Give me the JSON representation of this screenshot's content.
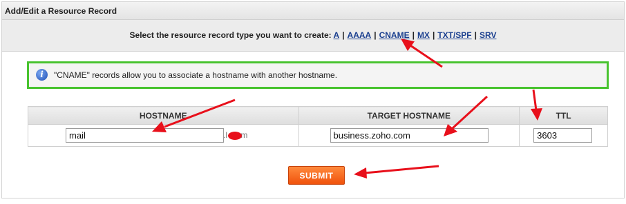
{
  "panel": {
    "title": "Add/Edit a Resource Record"
  },
  "type_selector": {
    "prompt": "Select the resource record type you want to create:",
    "separator": "|",
    "types": [
      "A",
      "AAAA",
      "CNAME",
      "MX",
      "TXT/SPF",
      "SRV"
    ]
  },
  "info": {
    "icon": "info-icon",
    "text": "\"CNAME\" records allow you to associate a hostname with another hostname."
  },
  "table": {
    "headers": {
      "hostname": "HOSTNAME",
      "target": "TARGET HOSTNAME",
      "ttl": "TTL"
    },
    "row": {
      "hostname_value": "mail",
      "domain_suffix": ".l    .com",
      "target_value": "business.zoho.com",
      "ttl_value": "3603"
    }
  },
  "submit_label": "SUBMIT",
  "colors": {
    "info_border": "#48c32f",
    "link": "#1a3f8f",
    "submit": "#f0520c",
    "annotation_arrow": "#e8101b"
  }
}
